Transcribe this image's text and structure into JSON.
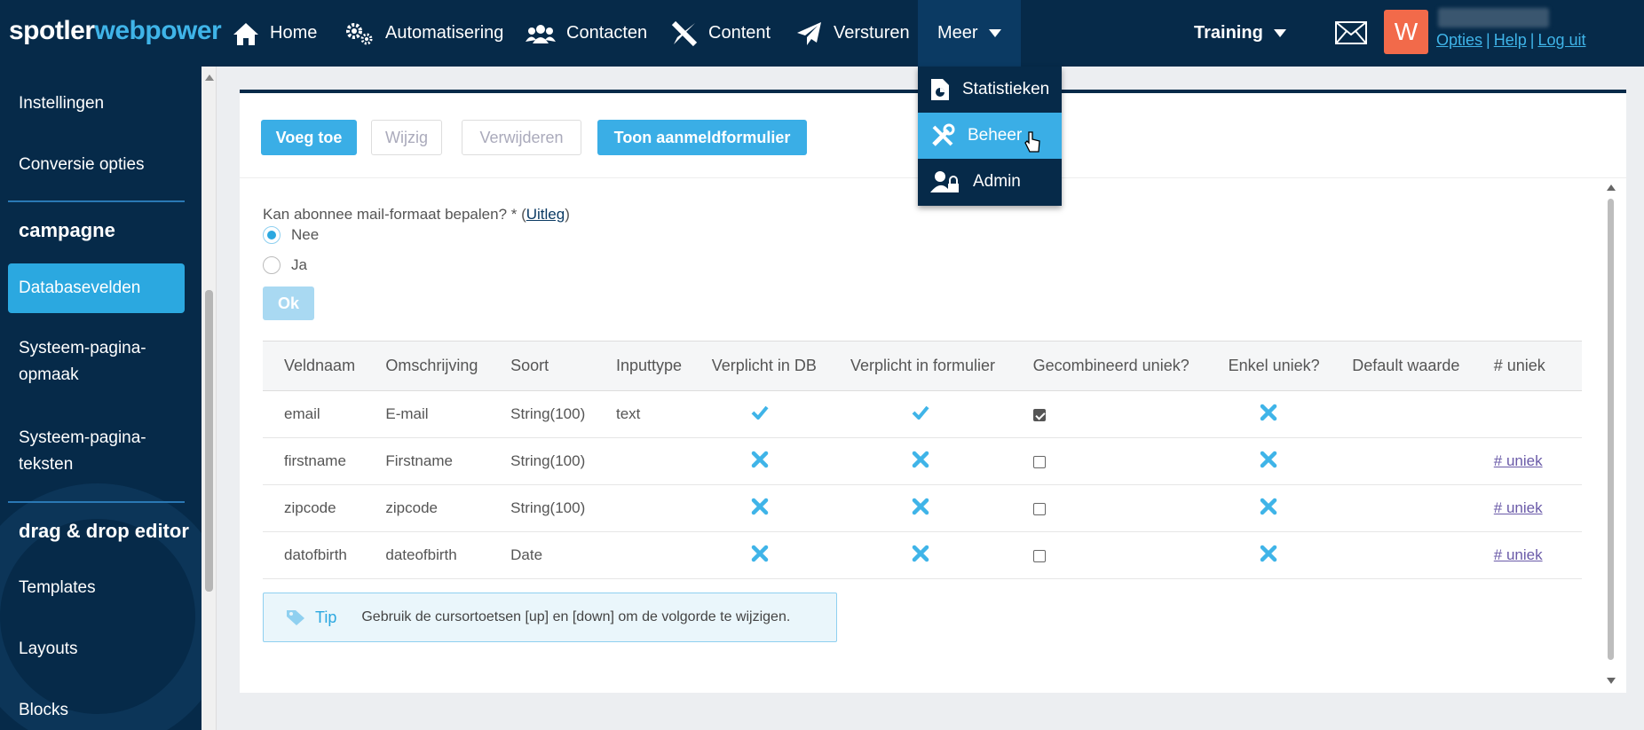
{
  "brand": {
    "part1": "spotler",
    "part2": "webpower"
  },
  "nav": {
    "home": "Home",
    "automatisering": "Automatisering",
    "contacten": "Contacten",
    "content": "Content",
    "versturen": "Versturen",
    "meer": "Meer",
    "training": "Training"
  },
  "user": {
    "initial": "W",
    "links": {
      "opties": "Opties",
      "help": "Help",
      "logout": "Log uit",
      "separator": "|"
    }
  },
  "meer_menu": {
    "statistieken": "Statistieken",
    "beheer": "Beheer",
    "admin": "Admin"
  },
  "sidebar": {
    "instellingen": "Instellingen",
    "conversie": "Conversie opties",
    "campagne_heading": "campagne",
    "databasevelden": "Databasevelden",
    "systeem_opmaak_1": "Systeem-pagina-",
    "systeem_opmaak_2": "opmaak",
    "systeem_teksten_1": "Systeem-pagina-",
    "systeem_teksten_2": "teksten",
    "dnd_heading": "drag & drop editor",
    "templates": "Templates",
    "layouts": "Layouts",
    "blocks": "Blocks"
  },
  "toolbar": {
    "voeg_toe": "Voeg toe",
    "wijzig": "Wijzig",
    "verwijderen": "Verwijderen",
    "toon": "Toon aanmeldformulier"
  },
  "question": {
    "text": "Kan abonnee mail-formaat bepalen? * (",
    "link": "Uitleg",
    "close": ")",
    "option_no": "Nee",
    "option_yes": "Ja",
    "selected": "Nee",
    "ok": "Ok"
  },
  "table": {
    "headers": {
      "veldnaam": "Veldnaam",
      "omschrijving": "Omschrijving",
      "soort": "Soort",
      "inputtype": "Inputtype",
      "verplicht_db": "Verplicht in DB",
      "verplicht_form": "Verplicht in formulier",
      "gecombineerd": "Gecombineerd uniek?",
      "enkel": "Enkel uniek?",
      "default": "Default waarde",
      "uniek": "# uniek"
    },
    "rows": [
      {
        "veldnaam": "email",
        "omschrijving": "E-mail",
        "soort": "String(100)",
        "inputtype": "text",
        "verplicht_db": true,
        "verplicht_form": true,
        "gecombineerd": true,
        "enkel": false,
        "uniek_link": ""
      },
      {
        "veldnaam": "firstname",
        "omschrijving": "Firstname",
        "soort": "String(100)",
        "inputtype": "",
        "verplicht_db": false,
        "verplicht_form": false,
        "gecombineerd": false,
        "enkel": false,
        "uniek_link": "# uniek"
      },
      {
        "veldnaam": "zipcode",
        "omschrijving": "zipcode",
        "soort": "String(100)",
        "inputtype": "",
        "verplicht_db": false,
        "verplicht_form": false,
        "gecombineerd": false,
        "enkel": false,
        "uniek_link": "# uniek"
      },
      {
        "veldnaam": "datofbirth",
        "omschrijving": "dateofbirth",
        "soort": "Date",
        "inputtype": "",
        "verplicht_db": false,
        "verplicht_form": false,
        "gecombineerd": false,
        "enkel": false,
        "uniek_link": "# uniek"
      }
    ]
  },
  "tip": {
    "label": "Tip",
    "text": "Gebruik de cursortoetsen [up] en [down] om de volgorde te wijzigen."
  },
  "colors": {
    "navy": "#062a49",
    "accent": "#3aaee6",
    "avatar": "#f26a4a",
    "check": "#3fb4e8"
  }
}
